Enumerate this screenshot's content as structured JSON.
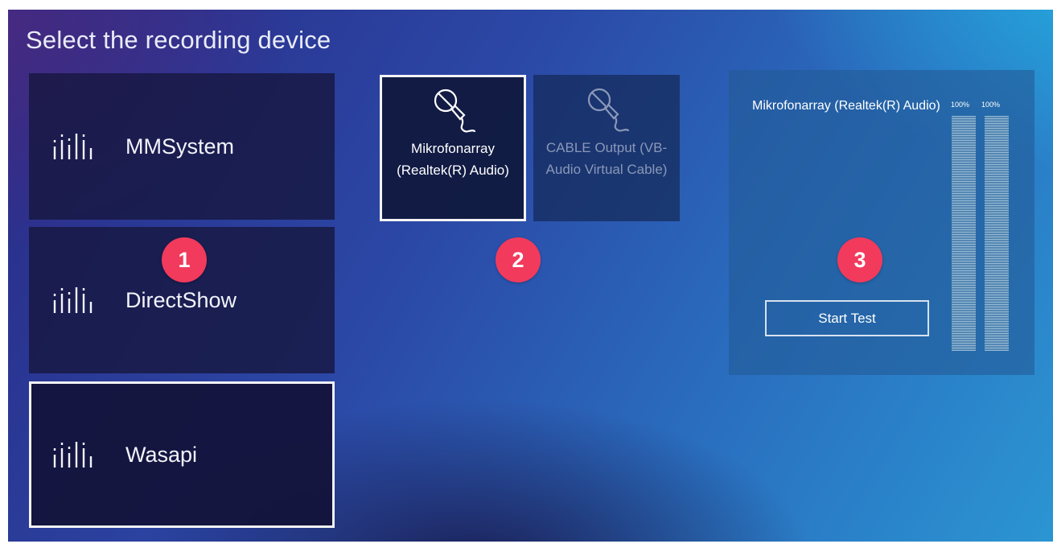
{
  "page": {
    "title": "Select the recording device"
  },
  "api_buttons": [
    {
      "label": "MMSystem",
      "selected": false,
      "icon": "audio-levels-icon"
    },
    {
      "label": "DirectShow",
      "selected": false,
      "icon": "audio-levels-icon"
    },
    {
      "label": "Wasapi",
      "selected": true,
      "icon": "audio-levels-icon"
    }
  ],
  "devices": [
    {
      "name": "Mikrofonarray (Realtek(R) Audio)",
      "selected": true,
      "icon": "microphone-icon"
    },
    {
      "name": "CABLE Output (VB-Audio Virtual Cable)",
      "selected": false,
      "icon": "microphone-icon"
    }
  ],
  "test_panel": {
    "device_name": "Mikrofonarray (Realtek(R) Audio)",
    "start_label": "Start Test",
    "meters": [
      {
        "label": "100%",
        "level": 1.0
      },
      {
        "label": "100%",
        "level": 1.0
      }
    ]
  },
  "markers": [
    "1",
    "2",
    "3"
  ],
  "colors": {
    "marker": "#f23a5c",
    "border": "#f3f3f5"
  }
}
